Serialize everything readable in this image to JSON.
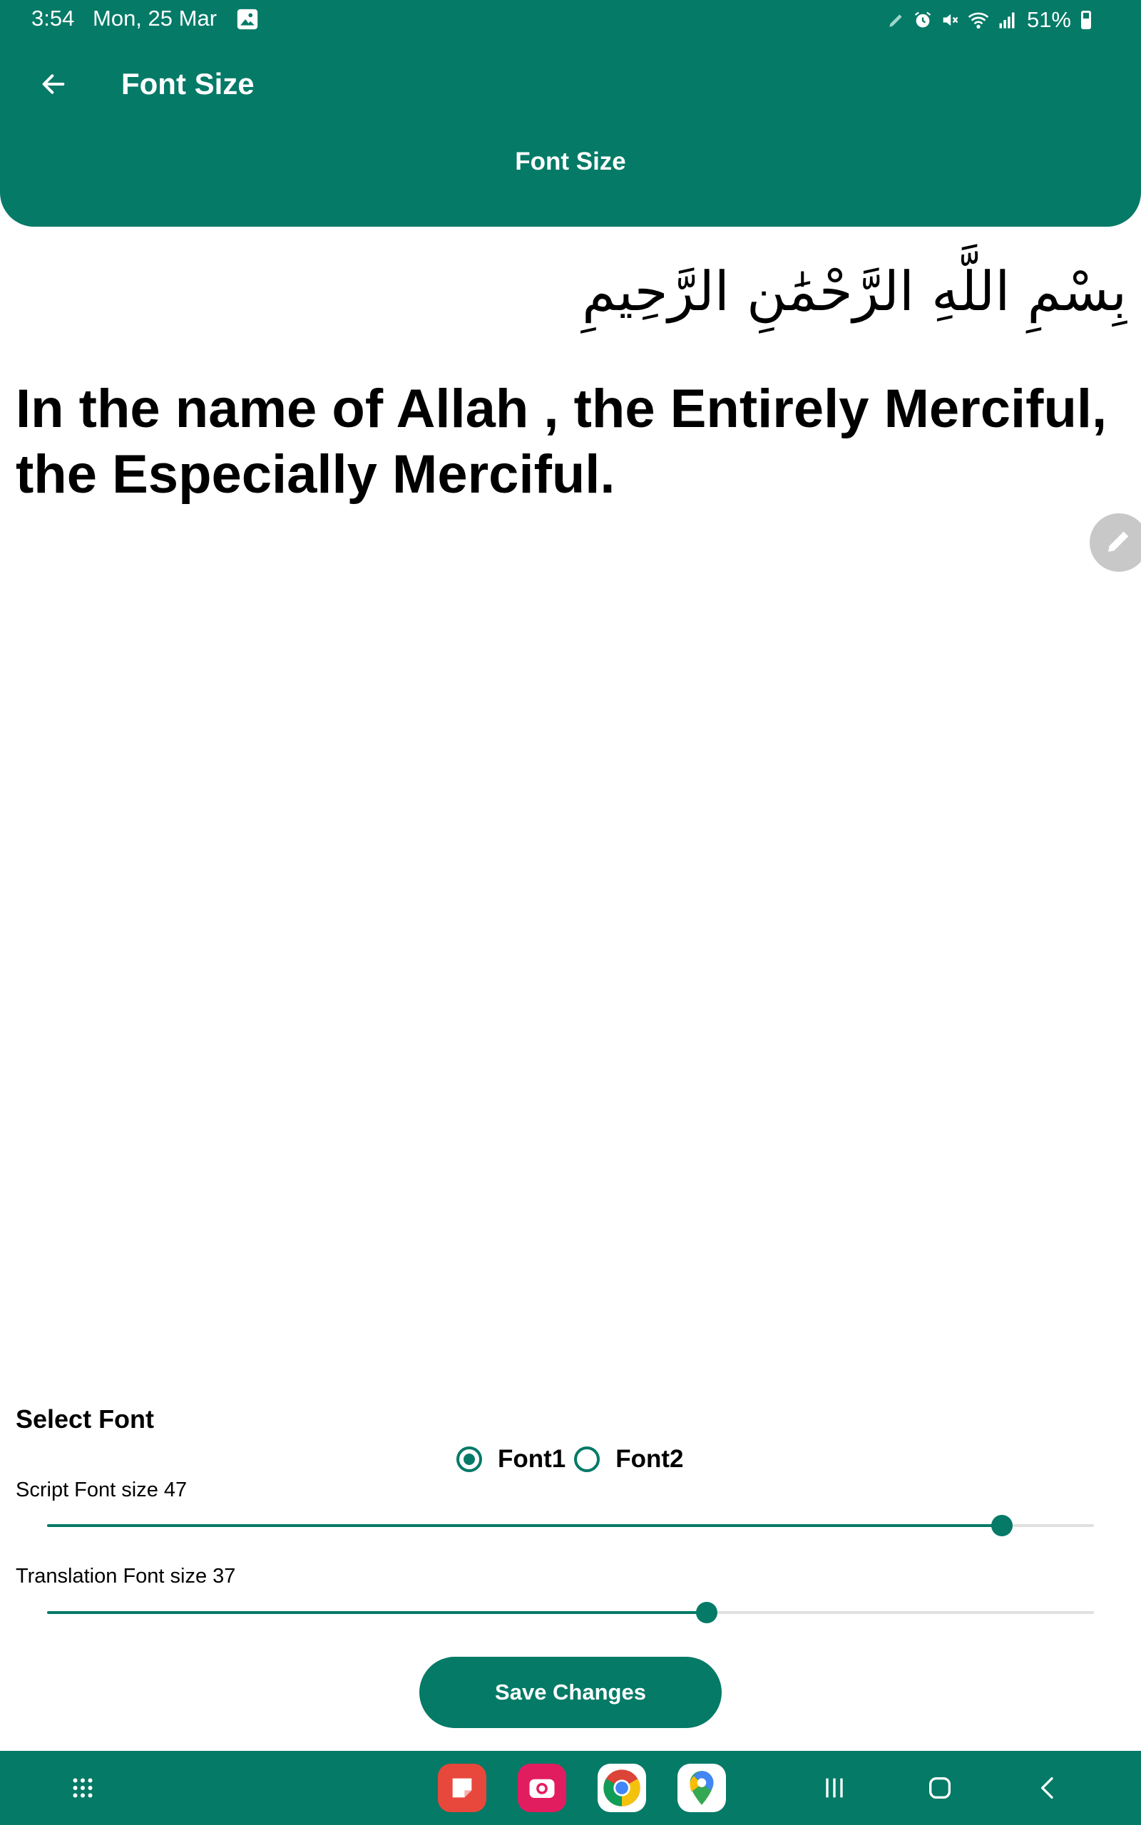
{
  "status_bar": {
    "time": "3:54",
    "date": "Mon, 25 Mar",
    "battery": "51%"
  },
  "toolbar": {
    "title": "Font Size",
    "back_icon": "arrow-left-icon"
  },
  "header": {
    "subtitle": "Font Size"
  },
  "content": {
    "arabic": "بِسْمِ اللَّهِ الرَّحْمَٰنِ الرَّحِيمِ",
    "translation": "In the name of Allah , the Entirely Merciful, the Especially Merciful."
  },
  "controls": {
    "select_font_label": "Select Font",
    "fonts": [
      {
        "label": "Font1",
        "selected": true
      },
      {
        "label": "Font2",
        "selected": false
      }
    ],
    "script_label": "Script Font size",
    "script_value": "47",
    "script_fraction": 0.912,
    "translation_label": "Translation Font size",
    "translation_value": "37",
    "translation_fraction": 0.63,
    "save_label": "Save Changes"
  },
  "nav_bar": {
    "apps": [
      "apps-grid-icon",
      "notes-app-icon",
      "camera-app-icon",
      "chrome-app-icon",
      "maps-app-icon"
    ],
    "buttons": [
      "recents-icon",
      "home-icon",
      "back-icon"
    ]
  },
  "colors": {
    "accent": "#047a67",
    "track": "#e0e0e0",
    "fab": "#c8c8c8"
  }
}
